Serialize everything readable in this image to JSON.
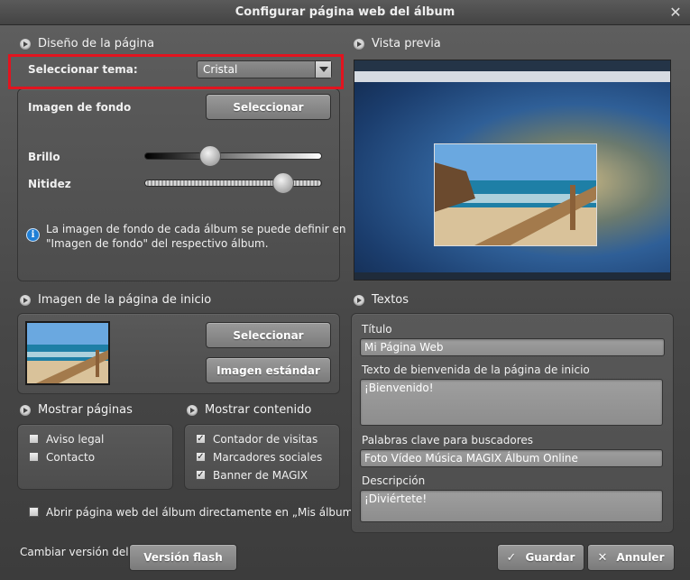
{
  "window": {
    "title": "Configurar página web del álbum"
  },
  "design": {
    "heading": "Diseño de la página",
    "theme_label": "Seleccionar tema:",
    "theme_value": "Cristal",
    "background_label": "Imagen de fondo",
    "select_button": "Seleccionar",
    "brightness_label": "Brillo",
    "brightness_value": 0.34,
    "sharpness_label": "Nitidez",
    "sharpness_value": 0.78,
    "info_text_line1": "La imagen de fondo de cada álbum se puede definir en",
    "info_text_line2": "\"Imagen de fondo\" del respectivo álbum."
  },
  "preview": {
    "heading": "Vista previa"
  },
  "home_image": {
    "heading": "Imagen de la página de inicio",
    "select_button": "Seleccionar",
    "standard_button": "Imagen estándar"
  },
  "show_pages": {
    "heading": "Mostrar páginas",
    "items": [
      {
        "label": "Aviso legal",
        "checked": false
      },
      {
        "label": "Contacto",
        "checked": false
      }
    ]
  },
  "show_content": {
    "heading": "Mostrar contenido",
    "items": [
      {
        "label": "Contador de visitas",
        "checked": true
      },
      {
        "label": "Marcadores sociales",
        "checked": true
      },
      {
        "label": "Banner de MAGIX",
        "checked": true
      }
    ]
  },
  "open_directly": {
    "label": "Abrir página web del álbum directamente en „Mis álbumes\"",
    "checked": false
  },
  "texts": {
    "heading": "Textos",
    "title_label": "Título",
    "title_value": "Mi Página Web",
    "welcome_label": "Texto de bienvenida de la página de inicio",
    "welcome_value": "¡Bienvenido!",
    "keywords_label": "Palabras clave para buscadores",
    "keywords_value": "Foto Vídeo Música MAGIX Álbum Online",
    "description_label": "Descripción",
    "description_value": "¡Diviértete!"
  },
  "footer": {
    "change_version_label": "Cambiar versión del",
    "flash_button": "Versión flash",
    "save_button": "Guardar",
    "cancel_button": "Annuler"
  },
  "colors": {
    "highlight": "#e2141f",
    "info": "#1f7fd6"
  }
}
